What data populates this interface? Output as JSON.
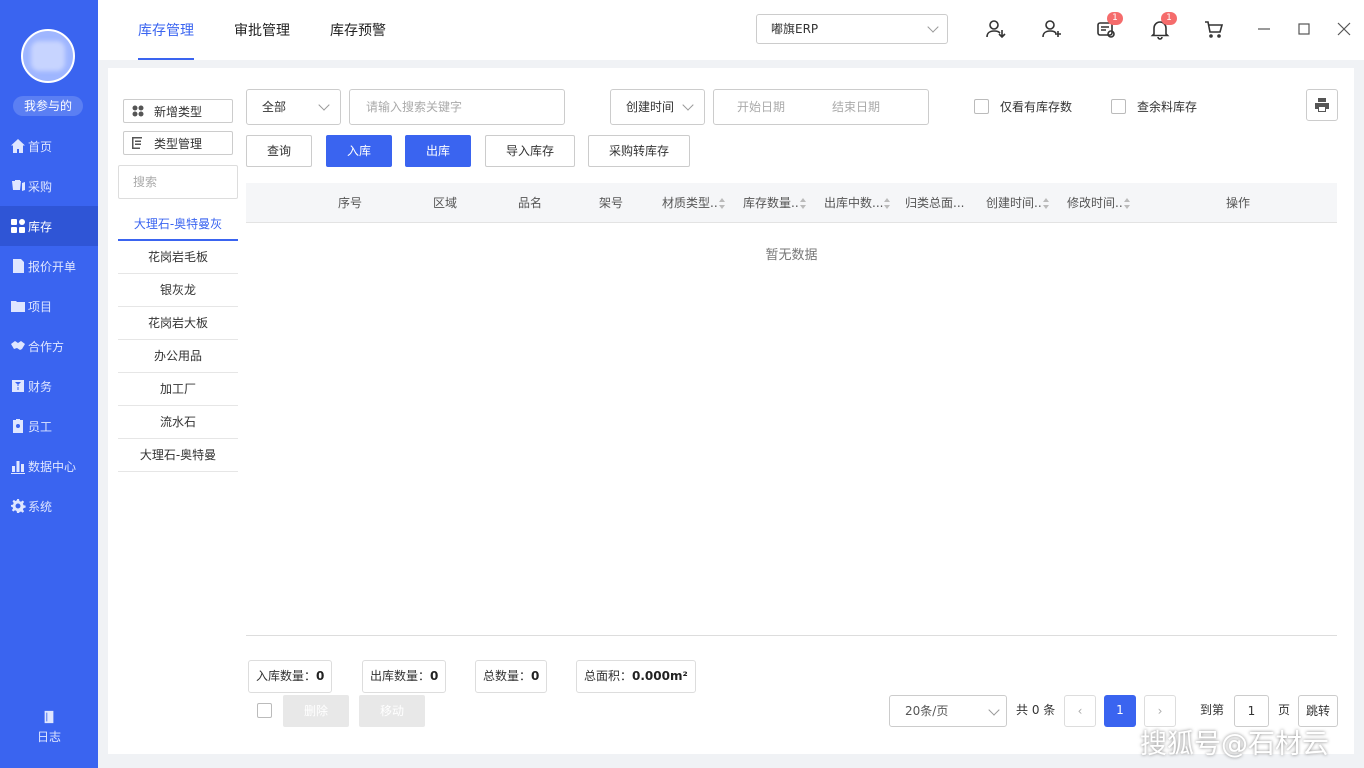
{
  "sidebar": {
    "me_label": "我参与的",
    "items": [
      {
        "label": "首页",
        "icon": "home-icon"
      },
      {
        "label": "采购",
        "icon": "purchase-icon"
      },
      {
        "label": "库存",
        "icon": "grid-icon"
      },
      {
        "label": "报价开单",
        "icon": "document-icon"
      },
      {
        "label": "项目",
        "icon": "project-icon"
      },
      {
        "label": "合作方",
        "icon": "handshake-icon"
      },
      {
        "label": "财务",
        "icon": "finance-icon"
      },
      {
        "label": "员工",
        "icon": "staff-icon"
      },
      {
        "label": "数据中心",
        "icon": "chart-icon"
      },
      {
        "label": "系统",
        "icon": "gear-icon"
      }
    ],
    "log_label": "日志"
  },
  "top_tabs": [
    "库存管理",
    "审批管理",
    "库存预警"
  ],
  "org_select": "嘟旗ERP",
  "badges": {
    "message": "1",
    "bell": "1"
  },
  "left_panel": {
    "add_type": "新增类型",
    "manage_type": "类型管理",
    "search_placeholder": "搜索",
    "categories": [
      "大理石-奥特曼灰",
      "花岗岩毛板",
      "银灰龙",
      "花岗岩大板",
      "办公用品",
      "加工厂",
      "流水石",
      "大理石-奥特曼"
    ]
  },
  "filters": {
    "scope": "全部",
    "keyword_placeholder": "请输入搜索关键字",
    "time_field": "创建时间",
    "start_date": "开始日期",
    "end_date": "结束日期",
    "only_stock": "仅看有库存数",
    "leftover": "查余料库存"
  },
  "actions": {
    "query": "查询",
    "in": "入库",
    "out": "出库",
    "import": "导入库存",
    "purchase": "采购转库存"
  },
  "table": {
    "columns": [
      "序号",
      "区域",
      "品名",
      "架号",
      "材质类型..",
      "库存数量..",
      "出库中数...",
      "归类总面...",
      "创建时间..",
      "修改时间..",
      "操作"
    ],
    "empty_text": "暂无数据"
  },
  "stats": {
    "in_label": "入库数量：",
    "in_value": "0",
    "out_label": "出库数量：",
    "out_value": "0",
    "total_label": "总数量：",
    "total_value": "0",
    "area_label": "总面积：",
    "area_value": "0.000m²"
  },
  "bulk": {
    "delete": "删除",
    "move": "移动"
  },
  "pagination": {
    "page_size": "20条/页",
    "total": "共 0 条",
    "current": "1",
    "goto_prefix": "到第",
    "goto_value": "1",
    "goto_suffix": "页",
    "jump": "跳转"
  },
  "watermark": "搜狐号@石材云",
  "colors": {
    "accent": "#3a64f0",
    "badge": "#f56c6c"
  }
}
